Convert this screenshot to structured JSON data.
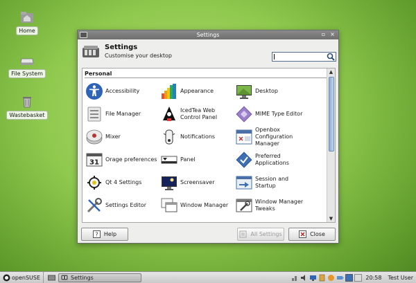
{
  "desktop": {
    "icons": [
      {
        "label": "Home",
        "icon": "home-folder-icon"
      },
      {
        "label": "File System",
        "icon": "drive-icon"
      },
      {
        "label": "Wastebasket",
        "icon": "trash-icon"
      }
    ]
  },
  "window": {
    "title": "Settings",
    "header_title": "Settings",
    "header_subtitle": "Customise your desktop",
    "search_value": "",
    "section": "Personal",
    "items": [
      {
        "label": "Accessibility",
        "icon": "accessibility-icon"
      },
      {
        "label": "Appearance",
        "icon": "appearance-icon"
      },
      {
        "label": "Desktop",
        "icon": "desktop-icon"
      },
      {
        "label": "File Manager",
        "icon": "file-manager-icon"
      },
      {
        "label": "IcedTea Web Control Panel",
        "icon": "icedtea-icon"
      },
      {
        "label": "MIME Type Editor",
        "icon": "mime-icon"
      },
      {
        "label": "Mixer",
        "icon": "mixer-icon"
      },
      {
        "label": "Notifications",
        "icon": "notifications-icon"
      },
      {
        "label": "Openbox Configuration Manager",
        "icon": "openbox-icon"
      },
      {
        "label": "Orage preferences",
        "icon": "calendar-icon"
      },
      {
        "label": "Panel",
        "icon": "panel-icon"
      },
      {
        "label": "Preferred Applications",
        "icon": "preferred-apps-icon"
      },
      {
        "label": "Qt 4 Settings",
        "icon": "qt-icon"
      },
      {
        "label": "Screensaver",
        "icon": "screensaver-icon"
      },
      {
        "label": "Session and Startup",
        "icon": "session-icon"
      },
      {
        "label": "Settings Editor",
        "icon": "settings-editor-icon"
      },
      {
        "label": "Window Manager",
        "icon": "window-manager-icon"
      },
      {
        "label": "Window Manager Tweaks",
        "icon": "wm-tweaks-icon"
      }
    ],
    "buttons": {
      "help": "Help",
      "all_settings": "All Settings",
      "close": "Close"
    }
  },
  "taskbar": {
    "start_label": "openSUSE",
    "task_label": "Settings",
    "clock": "20:58",
    "user": "Test User"
  }
}
